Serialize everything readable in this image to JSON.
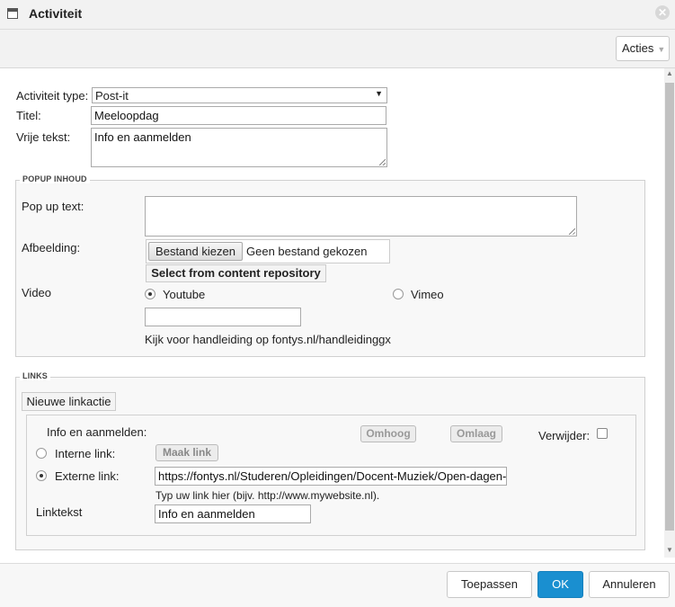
{
  "window": {
    "title": "Activiteit",
    "close_icon": "close-icon"
  },
  "toolbar": {
    "acties_label": "Acties",
    "acties_caret": "▼"
  },
  "form": {
    "activiteit_type_label": "Activiteit type:",
    "activiteit_type_value": "Post-it",
    "titel_label": "Titel:",
    "titel_value": "Meeloopdag",
    "vrije_tekst_label": "Vrije tekst:",
    "vrije_tekst_value": "Info en aanmelden"
  },
  "popup": {
    "legend": "POPUP INHOUD",
    "popup_text_label": "Pop up text:",
    "popup_text_value": "",
    "afbeelding_label": "Afbeelding:",
    "file_button_label": "Bestand kiezen",
    "file_status": "Geen bestand gekozen",
    "content_repo_label": "Select from content repository",
    "video_label": "Video",
    "youtube_label": "Youtube",
    "vimeo_label": "Vimeo",
    "video_selected": "Youtube",
    "video_url_value": "",
    "help_text": "Kijk voor handleiding op fontys.nl/handleidinggx"
  },
  "links": {
    "legend": "LINKS",
    "new_link_label": "Nieuwe linkactie",
    "items": [
      {
        "title": "Info en aanmelden:",
        "up_label": "Omhoog",
        "down_label": "Omlaag",
        "remove_label": "Verwijder:",
        "remove_checked": false,
        "internal_label": "Interne link:",
        "make_link_label": "Maak link",
        "external_label": "Externe link:",
        "selected": "external",
        "url_value": "https://fontys.nl/Studeren/Opleidingen/Docent-Muziek/Open-dagen-",
        "url_hint": "Typ uw link hier (bijv. http://www.mywebsite.nl).",
        "linktekst_label": "Linktekst",
        "linktekst_value": "Info en aanmelden"
      }
    ]
  },
  "footer": {
    "apply_label": "Toepassen",
    "ok_label": "OK",
    "cancel_label": "Annuleren"
  },
  "colors": {
    "ok_button": "#1a8fd0",
    "chrome_bg": "#f2f2f2",
    "fieldset_bg": "#f8f8f8"
  }
}
